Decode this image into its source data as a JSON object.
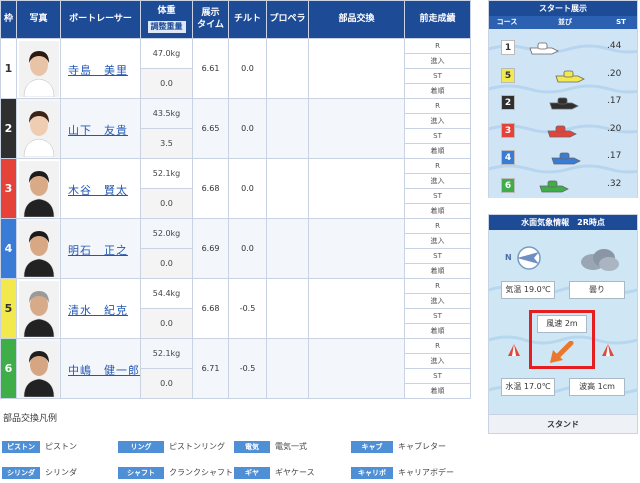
{
  "table": {
    "headers": {
      "frame": "枠",
      "photo": "写真",
      "racer": "ボートレーサー",
      "weight": "体重",
      "weight_sub": "調整重量",
      "exhibit_time": "展示\nタイム",
      "tilt": "チルト",
      "propeller": "プロペラ",
      "parts": "部品交換",
      "prev": "前走成績"
    },
    "prev_labels": [
      "R",
      "進入",
      "ST",
      "着順"
    ],
    "rows": [
      {
        "frame": "1",
        "color": "#ffffff",
        "text_color": "#333333",
        "name": "寺島　美里",
        "weight": "47.0kg",
        "adjust": "0.0",
        "time": "6.61",
        "tilt": "0.0",
        "hair": "#2a1a10",
        "skin": "#e9c3a6",
        "outfit": "#ffffff"
      },
      {
        "frame": "2",
        "color": "#2f2f2f",
        "text_color": "#ffffff",
        "name": "山下　友貴",
        "weight": "43.5kg",
        "adjust": "3.5",
        "time": "6.65",
        "tilt": "0.0",
        "hair": "#3a2415",
        "skin": "#efcdb3",
        "outfit": "#ffffff"
      },
      {
        "frame": "3",
        "color": "#e5433a",
        "text_color": "#ffffff",
        "name": "木谷　賢太",
        "weight": "52.1kg",
        "adjust": "0.0",
        "time": "6.68",
        "tilt": "0.0",
        "hair": "#1c1c1c",
        "skin": "#d9aa86",
        "outfit": "#222222"
      },
      {
        "frame": "4",
        "color": "#3a7bd5",
        "text_color": "#ffffff",
        "name": "明石　正之",
        "weight": "52.0kg",
        "adjust": "0.0",
        "time": "6.69",
        "tilt": "0.0",
        "hair": "#1a1a1a",
        "skin": "#d8a885",
        "outfit": "#222222"
      },
      {
        "frame": "5",
        "color": "#f2e94e",
        "text_color": "#333333",
        "name": "清水　紀克",
        "weight": "54.4kg",
        "adjust": "0.0",
        "time": "6.68",
        "tilt": "-0.5",
        "hair": "#9a9a9a",
        "skin": "#d7ab8a",
        "outfit": "#222222"
      },
      {
        "frame": "6",
        "color": "#3fae49",
        "text_color": "#ffffff",
        "name": "中嶋　健一郎",
        "weight": "52.1kg",
        "adjust": "0.0",
        "time": "6.71",
        "tilt": "-0.5",
        "hair": "#1e1e1e",
        "skin": "#d6a683",
        "outfit": "#222222"
      }
    ]
  },
  "legend": {
    "title": "部品交換凡例",
    "items": [
      {
        "tag": "ピストン",
        "desc": "ピストン"
      },
      {
        "tag": "リング",
        "desc": "ピストンリング"
      },
      {
        "tag": "電気",
        "desc": "電気一式"
      },
      {
        "tag": "キャブ",
        "desc": "キャブレター"
      },
      {
        "tag": "シリンダ",
        "desc": "シリンダ"
      },
      {
        "tag": "シャフト",
        "desc": "クランクシャフト"
      },
      {
        "tag": "ギヤ",
        "desc": "ギヤケース"
      },
      {
        "tag": "キャリボ",
        "desc": "キャリアボデー"
      }
    ]
  },
  "start": {
    "title": "スタート展示",
    "headers": {
      "course": "コース",
      "order": "並び",
      "st": "ST"
    },
    "rows": [
      {
        "course": "1",
        "st": ".44",
        "color": "#ffffff",
        "text_color": "#333333"
      },
      {
        "course": "5",
        "st": ".20",
        "color": "#f2e94e",
        "text_color": "#333333"
      },
      {
        "course": "2",
        "st": ".17",
        "color": "#2f2f2f",
        "text_color": "#ffffff"
      },
      {
        "course": "3",
        "st": ".20",
        "color": "#e5433a",
        "text_color": "#ffffff"
      },
      {
        "course": "4",
        "st": ".17",
        "color": "#3a7bd5",
        "text_color": "#ffffff"
      },
      {
        "course": "6",
        "st": ".32",
        "color": "#3fae49",
        "text_color": "#ffffff"
      }
    ]
  },
  "weather": {
    "title": "水面気象情報　2R時点",
    "compass_label": "N",
    "air_temp": "気温 19.0℃",
    "condition": "曇り",
    "wind_speed": "風速 2m",
    "water_temp": "水温 17.0℃",
    "wave": "波高 1cm",
    "footer": "スタンド"
  }
}
